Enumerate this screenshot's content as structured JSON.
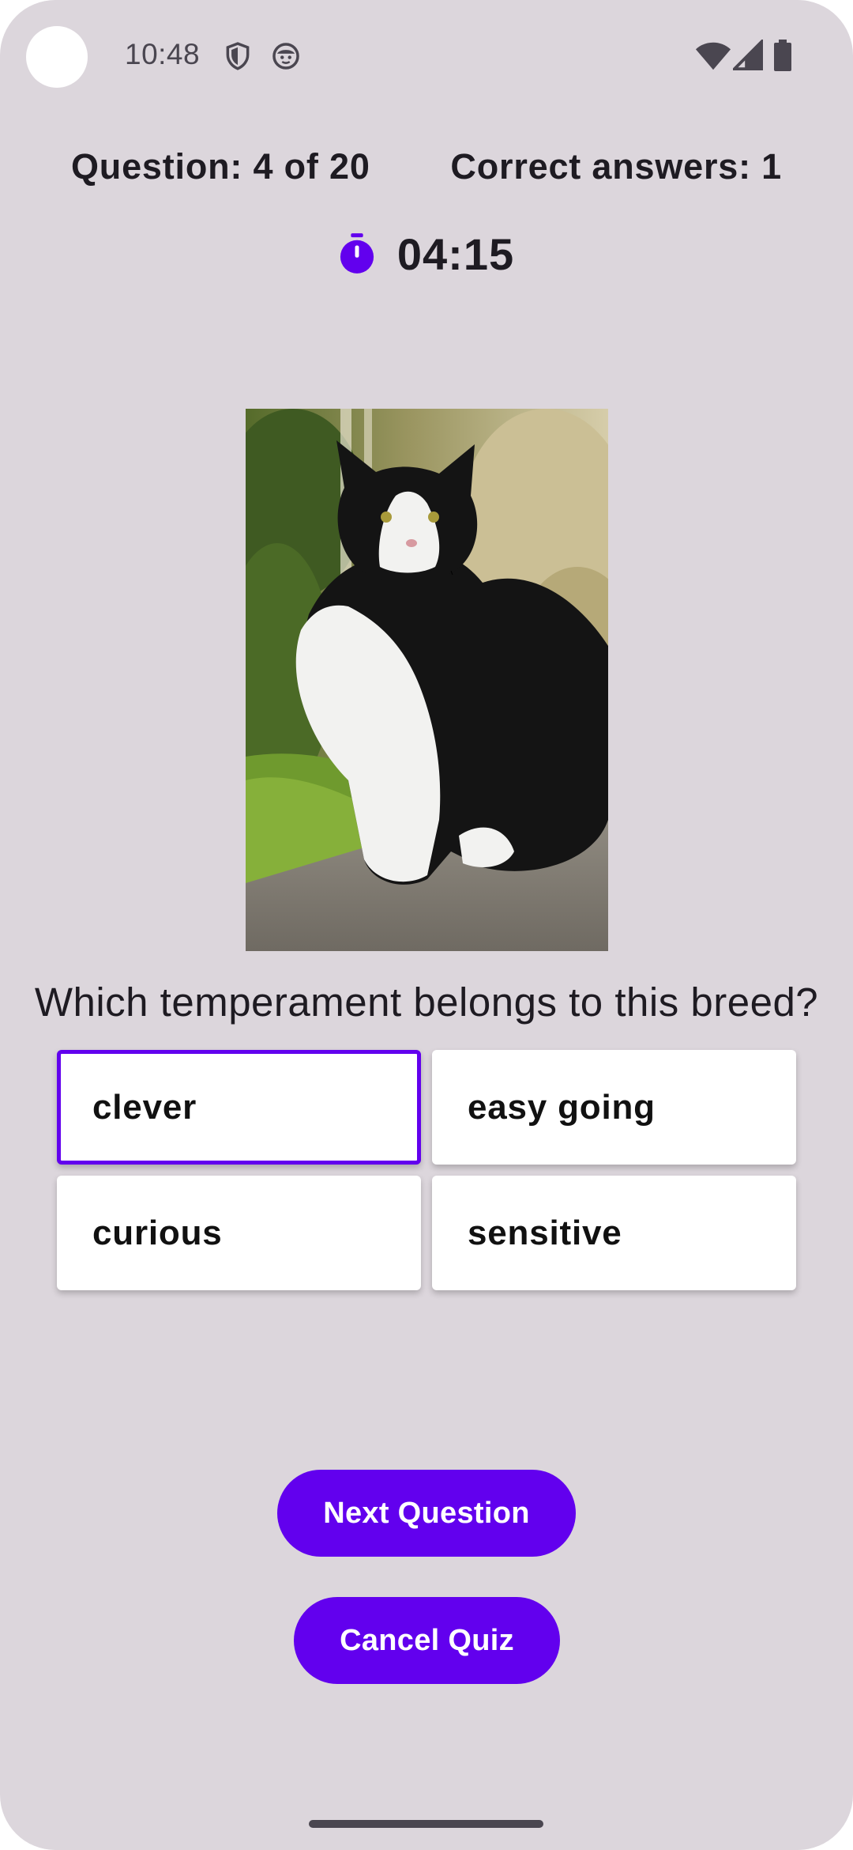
{
  "status_bar": {
    "time": "10:48",
    "icons_left": [
      "shield-icon",
      "face-icon"
    ],
    "icons_right": [
      "wifi-icon",
      "signal-icon",
      "battery-icon"
    ]
  },
  "quiz": {
    "question_counter": "Question: 4 of 20",
    "correct_answers": "Correct answers: 1",
    "timer": "04:15",
    "question": "Which temperament belongs to this breed?",
    "image_subject": "black-and-white long-haired cat sitting on a path",
    "answers": [
      {
        "label": "clever",
        "selected": true
      },
      {
        "label": "easy going",
        "selected": false
      },
      {
        "label": "curious",
        "selected": false
      },
      {
        "label": "sensitive",
        "selected": false
      }
    ]
  },
  "buttons": {
    "next": "Next Question",
    "cancel": "Cancel Quiz"
  },
  "colors": {
    "accent": "#6200ee",
    "background": "#dcd6dc",
    "text": "#1e1b22"
  }
}
